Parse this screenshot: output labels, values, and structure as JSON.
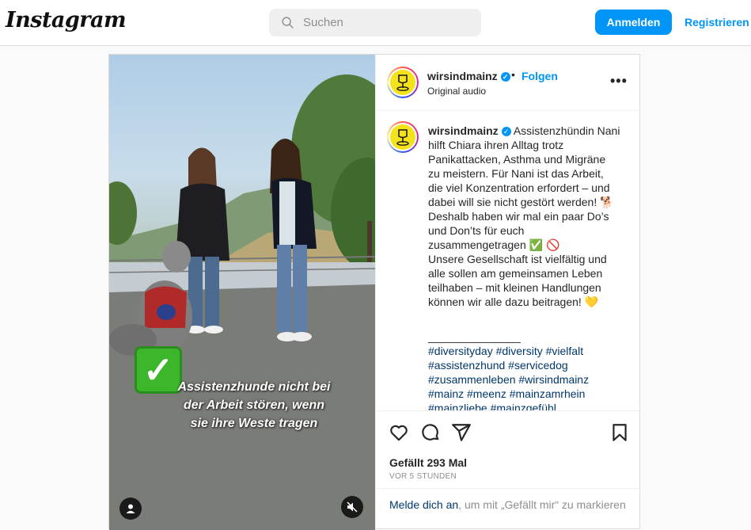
{
  "header": {
    "logo": "Instagram",
    "search_placeholder": "Suchen",
    "login_label": "Anmelden",
    "register_label": "Registrieren"
  },
  "video": {
    "overlay_check": "✓",
    "overlay_line1": "Assistenzhunde nicht bei",
    "overlay_line2": "der Arbeit stören, wenn",
    "overlay_line3": "sie ihre Weste tragen"
  },
  "post": {
    "username": "wirsindmainz",
    "separator": "•",
    "follow_label": "Folgen",
    "audio": "Original audio",
    "more": "•••",
    "caption_lines": [
      "Assistenzhündin Nani",
      "hilft Chiara ihren Alltag trotz",
      "Panikattacken, Asthma und Migräne",
      "zu meistern. Für Nani ist das Arbeit,",
      "die viel Konzentration erfordert – und",
      "dabei will sie nicht gestört werden! 🐕",
      "Deshalb haben wir mal ein paar Do’s",
      "und Don’ts für euch",
      "zusammengetragen ✅ 🚫",
      "Unsere Gesellschaft ist vielfältig und",
      "alle sollen am gemeinsamen Leben",
      "teilhaben – mit kleinen Handlungen",
      "können wir alle dazu beitragen! 💛",
      "",
      "_______________"
    ],
    "hashtag_lines": [
      "#diversityday #diversity #vielfalt",
      "#assistenzhund #servicedog",
      "#zusammenleben #wirsindmainz",
      "#mainz #meenz #mainzamrhein",
      "#mainzliebe #mainzgefühl"
    ],
    "likes": "Gefällt 293 Mal",
    "time": "VOR 5 STUNDEN",
    "login_link": "Melde dich an",
    "login_suffix": ", um mit „Gefällt mir“ zu markieren"
  },
  "colors": {
    "accent": "#0095f6",
    "avatar_bg": "#f4e21a",
    "check_green": "#3cb72b"
  }
}
